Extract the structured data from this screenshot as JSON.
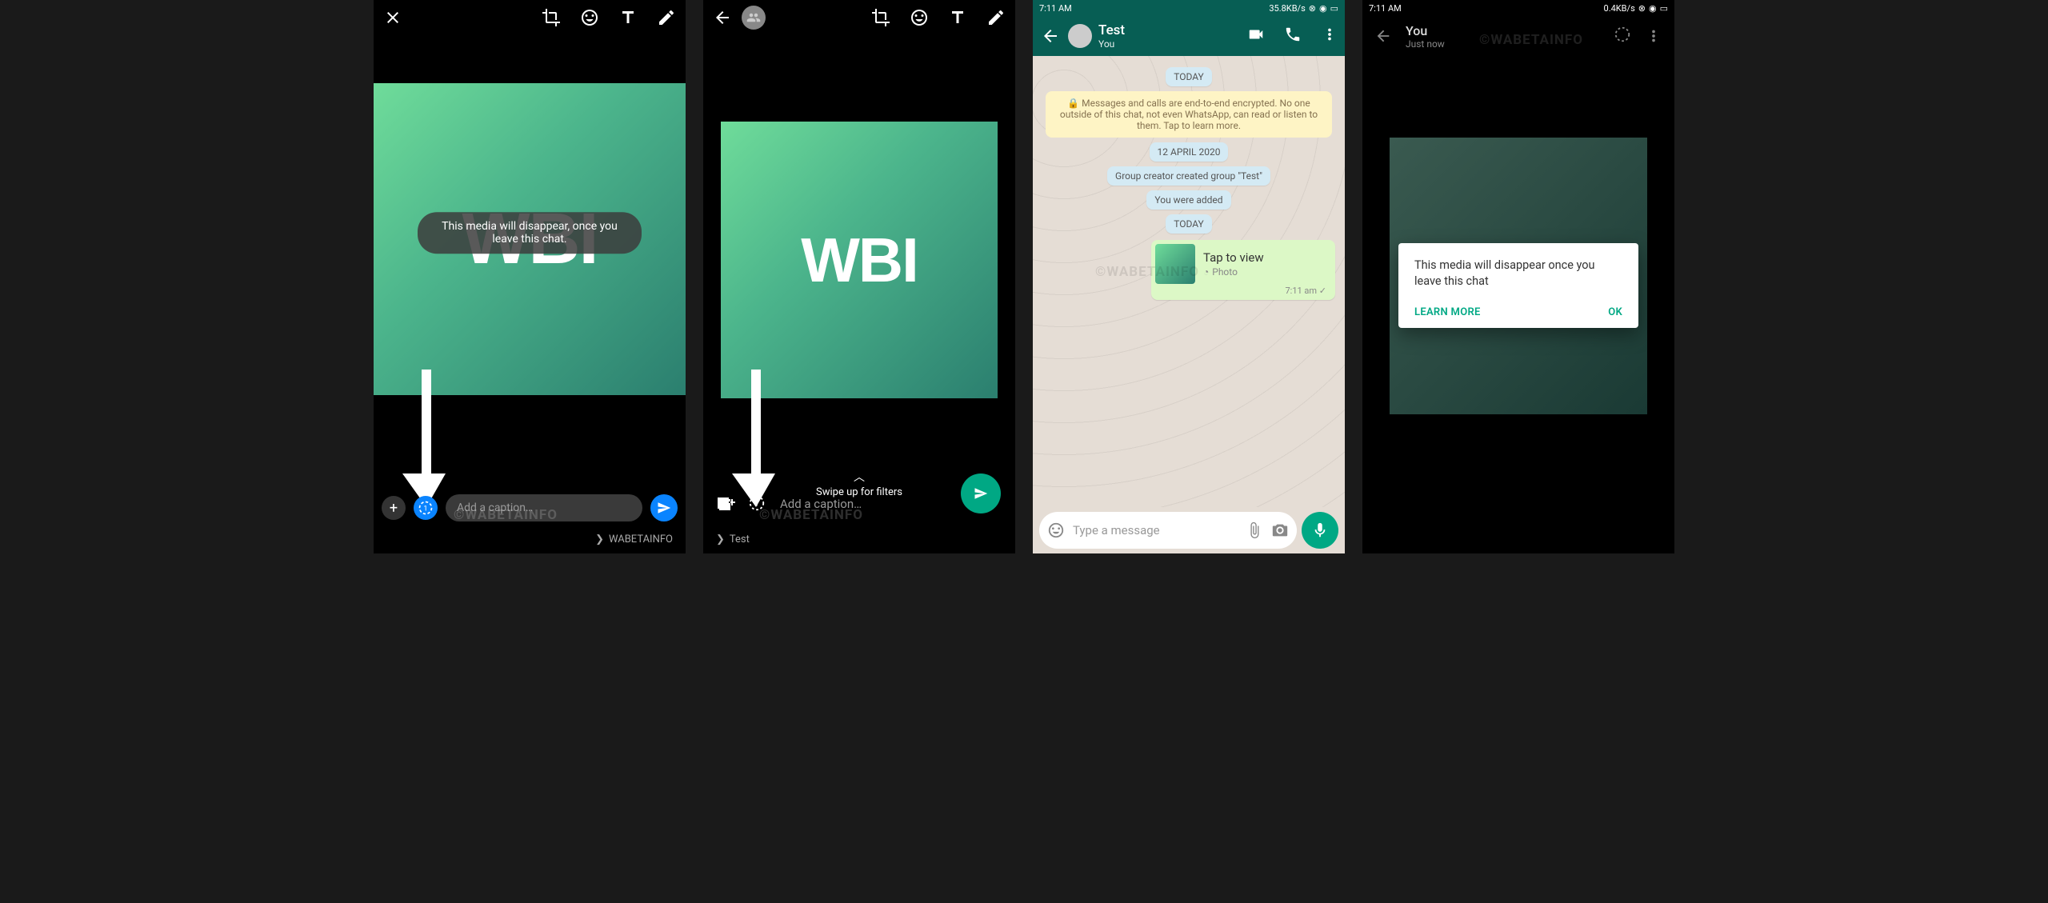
{
  "global": {
    "brand_watermark": "©WABETAINFO",
    "wbi_logo": "WBI"
  },
  "screen1": {
    "toast": "This media will disappear, once you leave this chat.",
    "caption_placeholder": "Add a caption…",
    "recipient_arrow": "❯",
    "recipient": "WABETAINFO"
  },
  "screen2": {
    "swipe_hint": "Swipe up for filters",
    "caption_placeholder": "Add a caption…",
    "recipient_arrow": "❯",
    "recipient": "Test"
  },
  "screen3": {
    "status_time": "7:11 AM",
    "status_net": "35.8KB/s",
    "chat_name": "Test",
    "chat_sub": "You",
    "pill_today1": "TODAY",
    "e2e": "🔒 Messages and calls are end-to-end encrypted. No one outside of this chat, not even WhatsApp, can read or listen to them. Tap to learn more.",
    "pill_date": "12 APRIL 2020",
    "pill_group": "Group creator created group \"Test\"",
    "pill_added": "You were added",
    "pill_today2": "TODAY",
    "msg_tap": "Tap to view",
    "msg_type": "Photo",
    "msg_time": "7:11 am ✓",
    "composer_placeholder": "Type a message"
  },
  "screen4": {
    "status_time": "7:11 AM",
    "status_net": "0.4KB/s",
    "sender": "You",
    "when": "Just now",
    "dialog_msg": "This media will disappear once you leave this chat",
    "learn": "LEARN MORE",
    "ok": "OK"
  }
}
